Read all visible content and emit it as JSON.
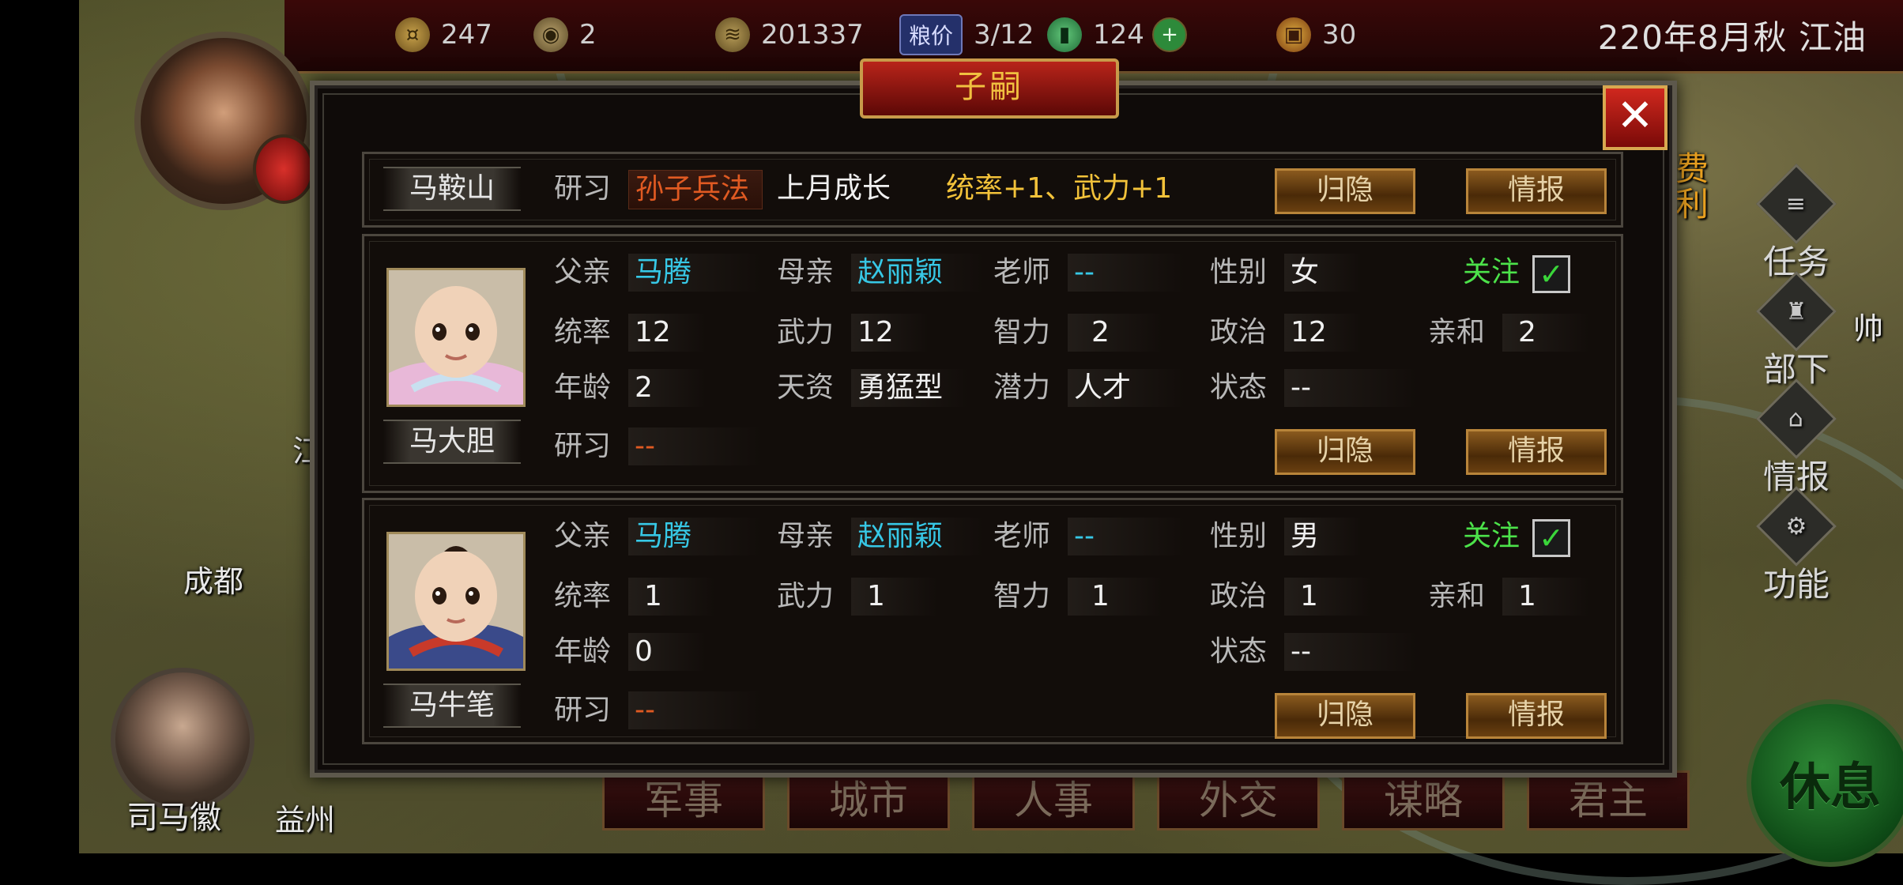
{
  "topbar": {
    "resources": [
      {
        "icon": "gold-icon",
        "value": "247"
      },
      {
        "icon": "coin-pouch-icon",
        "value": "2"
      },
      {
        "icon": "grain-icon",
        "value": "201337"
      },
      {
        "icon": "jade-icon",
        "value": "124"
      },
      {
        "icon": "token-icon",
        "value": "30"
      }
    ],
    "grain_price_label": "粮价",
    "grain_price_value": "3/12",
    "date_location": "220年8月秋 江油"
  },
  "map": {
    "labels": {
      "chengdu": "成都",
      "yizhou": "益州",
      "simahui": "司马徽",
      "fragment_left": "江"
    },
    "side_fragments": {
      "fei": "费",
      "li": "利",
      "shuai": "帅"
    }
  },
  "right_menu": [
    {
      "label": "任务",
      "icon": "scroll-icon"
    },
    {
      "label": "部下",
      "icon": "soldier-icon"
    },
    {
      "label": "情报",
      "icon": "building-icon"
    },
    {
      "label": "功能",
      "icon": "gear-icon"
    }
  ],
  "rest_button": "休息",
  "bottom_tabs": [
    "军事",
    "城市",
    "人事",
    "外交",
    "谋略",
    "君主"
  ],
  "dialog": {
    "title": "子嗣",
    "close_symbol": "✕",
    "children": [
      {
        "name": "马鞍山",
        "study_label": "研习",
        "study_value": "孙子兵法",
        "growth_label": "上月成长",
        "growth_value": "统率+1、武力+1",
        "retire_button": "归隐",
        "info_button": "情报"
      },
      {
        "name": "马大胆",
        "father_label": "父亲",
        "father": "马腾",
        "mother_label": "母亲",
        "mother": "赵丽颖",
        "teacher_label": "老师",
        "teacher": "--",
        "gender_label": "性别",
        "gender": "女",
        "follow_label": "关注",
        "follow_checked": true,
        "command_label": "统率",
        "command": "12",
        "force_label": "武力",
        "force": "12",
        "intellect_label": "智力",
        "intellect": "2",
        "politics_label": "政治",
        "politics": "12",
        "affinity_label": "亲和",
        "affinity": "2",
        "age_label": "年龄",
        "age": "2",
        "talent_label": "天资",
        "talent": "勇猛型",
        "potential_label": "潜力",
        "potential": "人才",
        "status_label": "状态",
        "status": "--",
        "study_label": "研习",
        "study": "--",
        "retire_button": "归隐",
        "info_button": "情报"
      },
      {
        "name": "马牛笔",
        "father_label": "父亲",
        "father": "马腾",
        "mother_label": "母亲",
        "mother": "赵丽颖",
        "teacher_label": "老师",
        "teacher": "--",
        "gender_label": "性别",
        "gender": "男",
        "follow_label": "关注",
        "follow_checked": true,
        "command_label": "统率",
        "command": "1",
        "force_label": "武力",
        "force": "1",
        "intellect_label": "智力",
        "intellect": "1",
        "politics_label": "政治",
        "politics": "1",
        "affinity_label": "亲和",
        "affinity": "1",
        "age_label": "年龄",
        "age": "0",
        "status_label": "状态",
        "status": "--",
        "study_label": "研习",
        "study": "--",
        "retire_button": "归隐",
        "info_button": "情报"
      }
    ]
  },
  "colors": {
    "dialog_bg": "#0f0b09",
    "title_red": "#b8241a",
    "cyan_text": "#37c8e6",
    "orange_text": "#e05a22",
    "yellow_text": "#f2c23a",
    "green_text": "#4ce24a",
    "button_gold": "#8a5a1e"
  }
}
